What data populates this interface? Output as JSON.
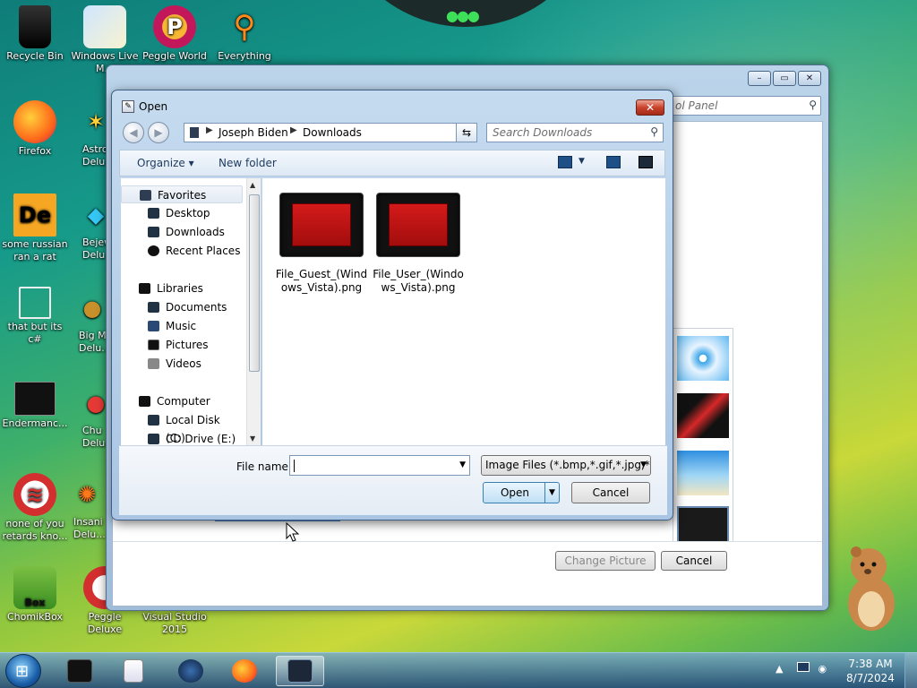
{
  "desktop": {
    "icons": [
      {
        "label": "Recycle Bin"
      },
      {
        "label": "Windows Live M..."
      },
      {
        "label": "Peggle World"
      },
      {
        "label": "Everything"
      },
      {
        "label": "Firefox"
      },
      {
        "label": "Astro Delu..."
      },
      {
        "label": "some russian ran a rat"
      },
      {
        "label": "Bejew Delu..."
      },
      {
        "label": "that but its c#"
      },
      {
        "label": "Big M Delu..."
      },
      {
        "label": "Endermanc..."
      },
      {
        "label": "Chu Delu..."
      },
      {
        "label": "none of you retards kno..."
      },
      {
        "label": "Insani Delu..."
      },
      {
        "label": "ChomikBox"
      },
      {
        "label": "Peggle Deluxe"
      },
      {
        "label": "Visual Studio 2015"
      }
    ]
  },
  "control_panel": {
    "search_placeholder": "ol Panel",
    "change_picture_label": "Change Picture",
    "cancel_label": "Cancel"
  },
  "dialog": {
    "title": "Open",
    "breadcrumb": [
      "Joseph Biden",
      "Downloads"
    ],
    "search_placeholder": "Search Downloads",
    "toolbar": {
      "organize": "Organize",
      "new_folder": "New folder"
    },
    "nav": {
      "favorites": "Favorites",
      "desktop": "Desktop",
      "downloads": "Downloads",
      "recent": "Recent Places",
      "libraries": "Libraries",
      "documents": "Documents",
      "music": "Music",
      "pictures": "Pictures",
      "videos": "Videos",
      "computer": "Computer",
      "local_disk": "Local Disk (C:)",
      "cd_drive": "CD Drive (E:)"
    },
    "files": [
      {
        "name": "File_Guest_(Windows_Vista).png"
      },
      {
        "name": "File_User_(Windows_Vista).png"
      }
    ],
    "file_name_label": "File name:",
    "file_name_value": "",
    "filter_value": "Image Files (*.bmp,*.gif,*.jpg,*.",
    "open_label": "Open",
    "cancel_label": "Cancel"
  },
  "taskbar": {
    "clock_time": "7:38 AM",
    "clock_date": "8/7/2024"
  }
}
